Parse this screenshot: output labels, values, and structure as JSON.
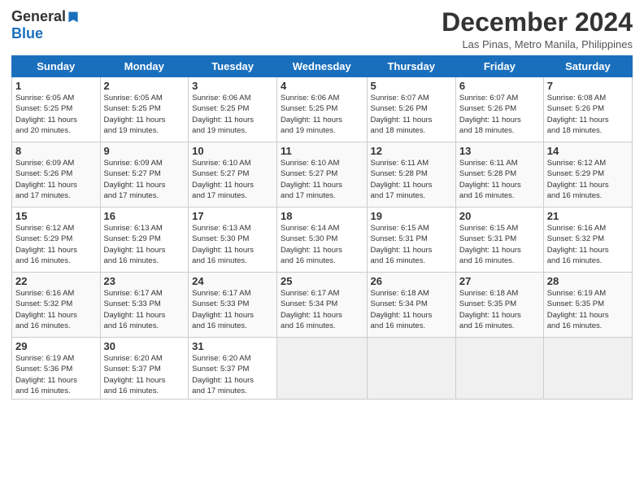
{
  "header": {
    "logo_general": "General",
    "logo_blue": "Blue",
    "month_year": "December 2024",
    "location": "Las Pinas, Metro Manila, Philippines"
  },
  "weekdays": [
    "Sunday",
    "Monday",
    "Tuesday",
    "Wednesday",
    "Thursday",
    "Friday",
    "Saturday"
  ],
  "weeks": [
    [
      {
        "day": "1",
        "info": "Sunrise: 6:05 AM\nSunset: 5:25 PM\nDaylight: 11 hours\nand 20 minutes."
      },
      {
        "day": "2",
        "info": "Sunrise: 6:05 AM\nSunset: 5:25 PM\nDaylight: 11 hours\nand 19 minutes."
      },
      {
        "day": "3",
        "info": "Sunrise: 6:06 AM\nSunset: 5:25 PM\nDaylight: 11 hours\nand 19 minutes."
      },
      {
        "day": "4",
        "info": "Sunrise: 6:06 AM\nSunset: 5:25 PM\nDaylight: 11 hours\nand 19 minutes."
      },
      {
        "day": "5",
        "info": "Sunrise: 6:07 AM\nSunset: 5:26 PM\nDaylight: 11 hours\nand 18 minutes."
      },
      {
        "day": "6",
        "info": "Sunrise: 6:07 AM\nSunset: 5:26 PM\nDaylight: 11 hours\nand 18 minutes."
      },
      {
        "day": "7",
        "info": "Sunrise: 6:08 AM\nSunset: 5:26 PM\nDaylight: 11 hours\nand 18 minutes."
      }
    ],
    [
      {
        "day": "8",
        "info": "Sunrise: 6:09 AM\nSunset: 5:26 PM\nDaylight: 11 hours\nand 17 minutes."
      },
      {
        "day": "9",
        "info": "Sunrise: 6:09 AM\nSunset: 5:27 PM\nDaylight: 11 hours\nand 17 minutes."
      },
      {
        "day": "10",
        "info": "Sunrise: 6:10 AM\nSunset: 5:27 PM\nDaylight: 11 hours\nand 17 minutes."
      },
      {
        "day": "11",
        "info": "Sunrise: 6:10 AM\nSunset: 5:27 PM\nDaylight: 11 hours\nand 17 minutes."
      },
      {
        "day": "12",
        "info": "Sunrise: 6:11 AM\nSunset: 5:28 PM\nDaylight: 11 hours\nand 17 minutes."
      },
      {
        "day": "13",
        "info": "Sunrise: 6:11 AM\nSunset: 5:28 PM\nDaylight: 11 hours\nand 16 minutes."
      },
      {
        "day": "14",
        "info": "Sunrise: 6:12 AM\nSunset: 5:29 PM\nDaylight: 11 hours\nand 16 minutes."
      }
    ],
    [
      {
        "day": "15",
        "info": "Sunrise: 6:12 AM\nSunset: 5:29 PM\nDaylight: 11 hours\nand 16 minutes."
      },
      {
        "day": "16",
        "info": "Sunrise: 6:13 AM\nSunset: 5:29 PM\nDaylight: 11 hours\nand 16 minutes."
      },
      {
        "day": "17",
        "info": "Sunrise: 6:13 AM\nSunset: 5:30 PM\nDaylight: 11 hours\nand 16 minutes."
      },
      {
        "day": "18",
        "info": "Sunrise: 6:14 AM\nSunset: 5:30 PM\nDaylight: 11 hours\nand 16 minutes."
      },
      {
        "day": "19",
        "info": "Sunrise: 6:15 AM\nSunset: 5:31 PM\nDaylight: 11 hours\nand 16 minutes."
      },
      {
        "day": "20",
        "info": "Sunrise: 6:15 AM\nSunset: 5:31 PM\nDaylight: 11 hours\nand 16 minutes."
      },
      {
        "day": "21",
        "info": "Sunrise: 6:16 AM\nSunset: 5:32 PM\nDaylight: 11 hours\nand 16 minutes."
      }
    ],
    [
      {
        "day": "22",
        "info": "Sunrise: 6:16 AM\nSunset: 5:32 PM\nDaylight: 11 hours\nand 16 minutes."
      },
      {
        "day": "23",
        "info": "Sunrise: 6:17 AM\nSunset: 5:33 PM\nDaylight: 11 hours\nand 16 minutes."
      },
      {
        "day": "24",
        "info": "Sunrise: 6:17 AM\nSunset: 5:33 PM\nDaylight: 11 hours\nand 16 minutes."
      },
      {
        "day": "25",
        "info": "Sunrise: 6:17 AM\nSunset: 5:34 PM\nDaylight: 11 hours\nand 16 minutes."
      },
      {
        "day": "26",
        "info": "Sunrise: 6:18 AM\nSunset: 5:34 PM\nDaylight: 11 hours\nand 16 minutes."
      },
      {
        "day": "27",
        "info": "Sunrise: 6:18 AM\nSunset: 5:35 PM\nDaylight: 11 hours\nand 16 minutes."
      },
      {
        "day": "28",
        "info": "Sunrise: 6:19 AM\nSunset: 5:35 PM\nDaylight: 11 hours\nand 16 minutes."
      }
    ],
    [
      {
        "day": "29",
        "info": "Sunrise: 6:19 AM\nSunset: 5:36 PM\nDaylight: 11 hours\nand 16 minutes."
      },
      {
        "day": "30",
        "info": "Sunrise: 6:20 AM\nSunset: 5:37 PM\nDaylight: 11 hours\nand 16 minutes."
      },
      {
        "day": "31",
        "info": "Sunrise: 6:20 AM\nSunset: 5:37 PM\nDaylight: 11 hours\nand 17 minutes."
      },
      null,
      null,
      null,
      null
    ]
  ]
}
